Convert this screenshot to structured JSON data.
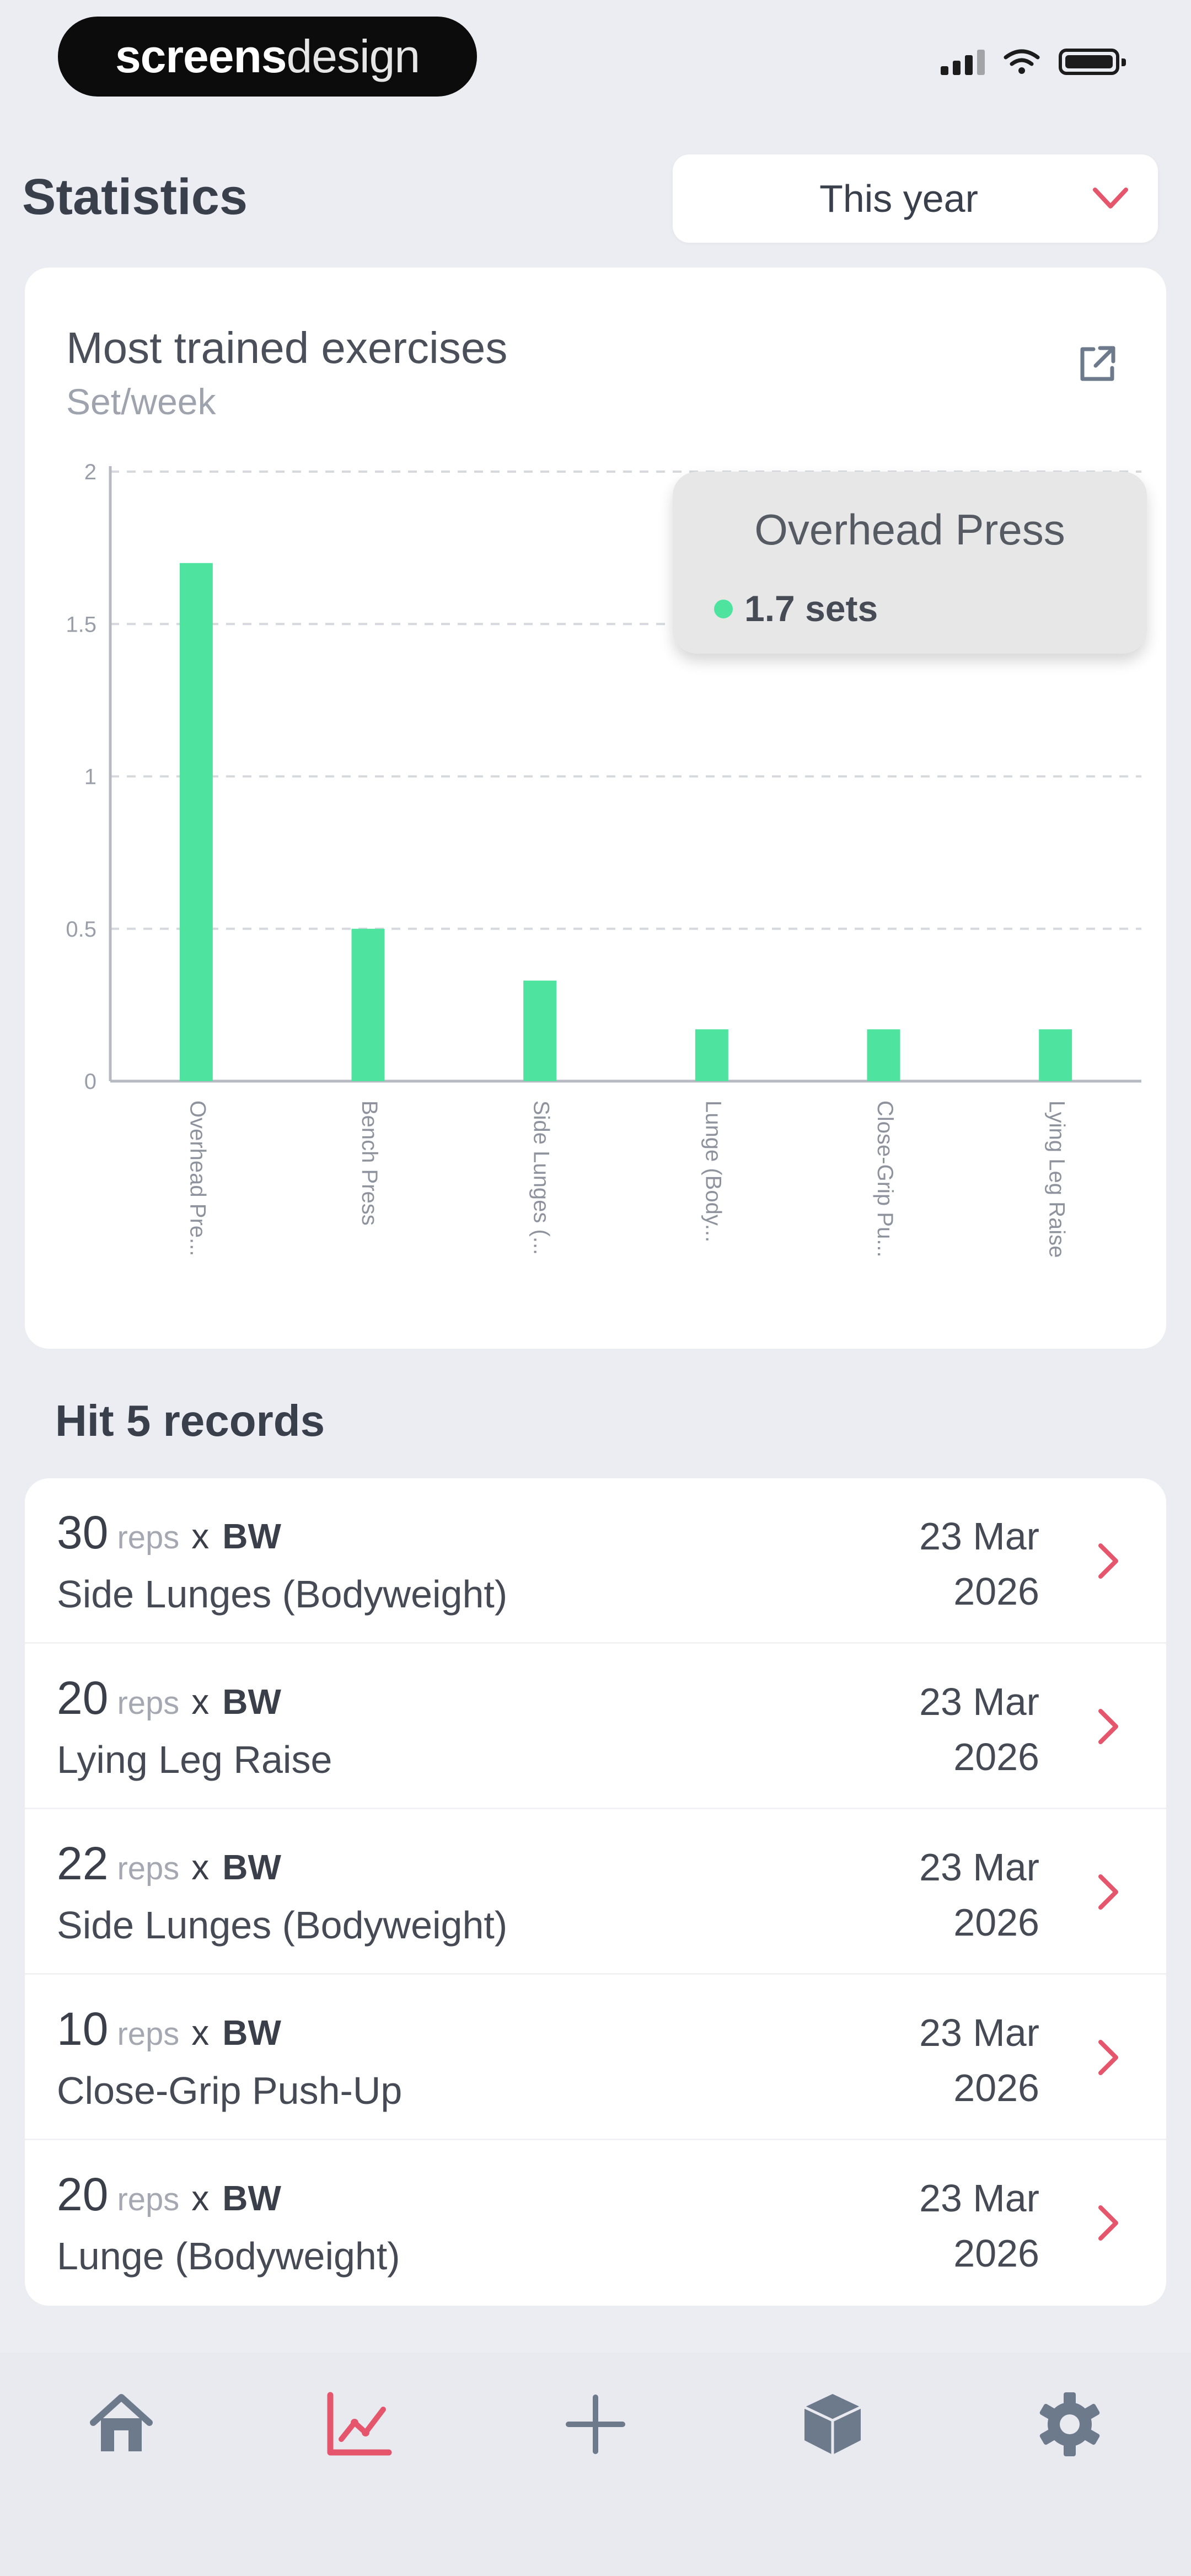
{
  "status_bar": {
    "brand_bold": "screens",
    "brand_light": "design"
  },
  "header": {
    "title": "Statistics",
    "period_selected": "This year"
  },
  "chart_card": {
    "title": "Most trained exercises",
    "subtitle": "Set/week",
    "tooltip": {
      "title": "Overhead Press",
      "value": "1.7 sets"
    }
  },
  "chart_data": {
    "type": "bar",
    "title": "Most trained exercises",
    "subtitle": "Set/week",
    "categories": [
      "Overhead Pre...",
      "Bench Press",
      "Side Lunges (...",
      "Lunge (Body...",
      "Close-Grip Pu...",
      "Lying Leg Raise"
    ],
    "values": [
      1.7,
      0.5,
      0.33,
      0.17,
      0.17,
      0.17
    ],
    "yticks": [
      "0",
      "0.5",
      "1",
      "1.5",
      "2"
    ],
    "ylim": [
      0,
      2
    ],
    "grid": true,
    "bar_color": "#4fe3a0"
  },
  "records": {
    "title": "Hit 5 records",
    "unit_label": "reps",
    "times": "x",
    "items": [
      {
        "reps": "30",
        "weight": "BW",
        "exercise": "Side Lunges (Bodyweight)",
        "date_line1": "23 Mar",
        "date_line2": "2026"
      },
      {
        "reps": "20",
        "weight": "BW",
        "exercise": "Lying Leg Raise",
        "date_line1": "23 Mar",
        "date_line2": "2026"
      },
      {
        "reps": "22",
        "weight": "BW",
        "exercise": "Side Lunges (Bodyweight)",
        "date_line1": "23 Mar",
        "date_line2": "2026"
      },
      {
        "reps": "10",
        "weight": "BW",
        "exercise": "Close-Grip Push-Up",
        "date_line1": "23 Mar",
        "date_line2": "2026"
      },
      {
        "reps": "20",
        "weight": "BW",
        "exercise": "Lunge (Bodyweight)",
        "date_line1": "23 Mar",
        "date_line2": "2026"
      }
    ]
  },
  "nav": {
    "items": [
      "home-icon",
      "statistics-icon",
      "plus-icon",
      "cube-icon",
      "settings-icon"
    ],
    "active": "statistics-icon"
  },
  "colors": {
    "accent": "#e5566c",
    "bar": "#4fe3a0",
    "nav_inactive": "#6d7a8c"
  }
}
